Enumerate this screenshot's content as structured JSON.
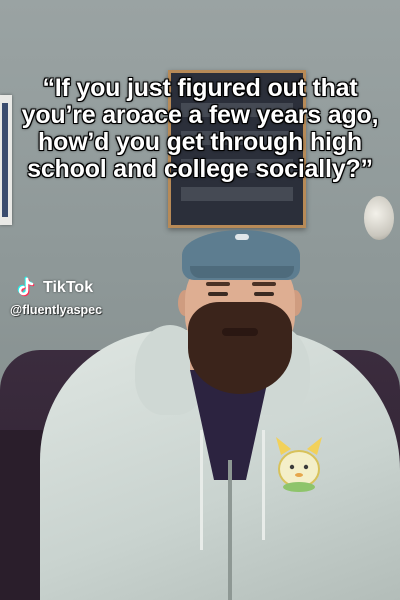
{
  "caption": {
    "text": "“If you just figured out that you’re aroace a few years ago, how’d you get through high school and college socially?”"
  },
  "watermark": {
    "brand": "TikTok",
    "handle": "@fluentlyaspec",
    "icon": "tiktok-note-icon"
  },
  "colors": {
    "caption_text": "#ffffff",
    "tiktok_cyan": "#25f4ee",
    "tiktok_red": "#fe2c55"
  }
}
